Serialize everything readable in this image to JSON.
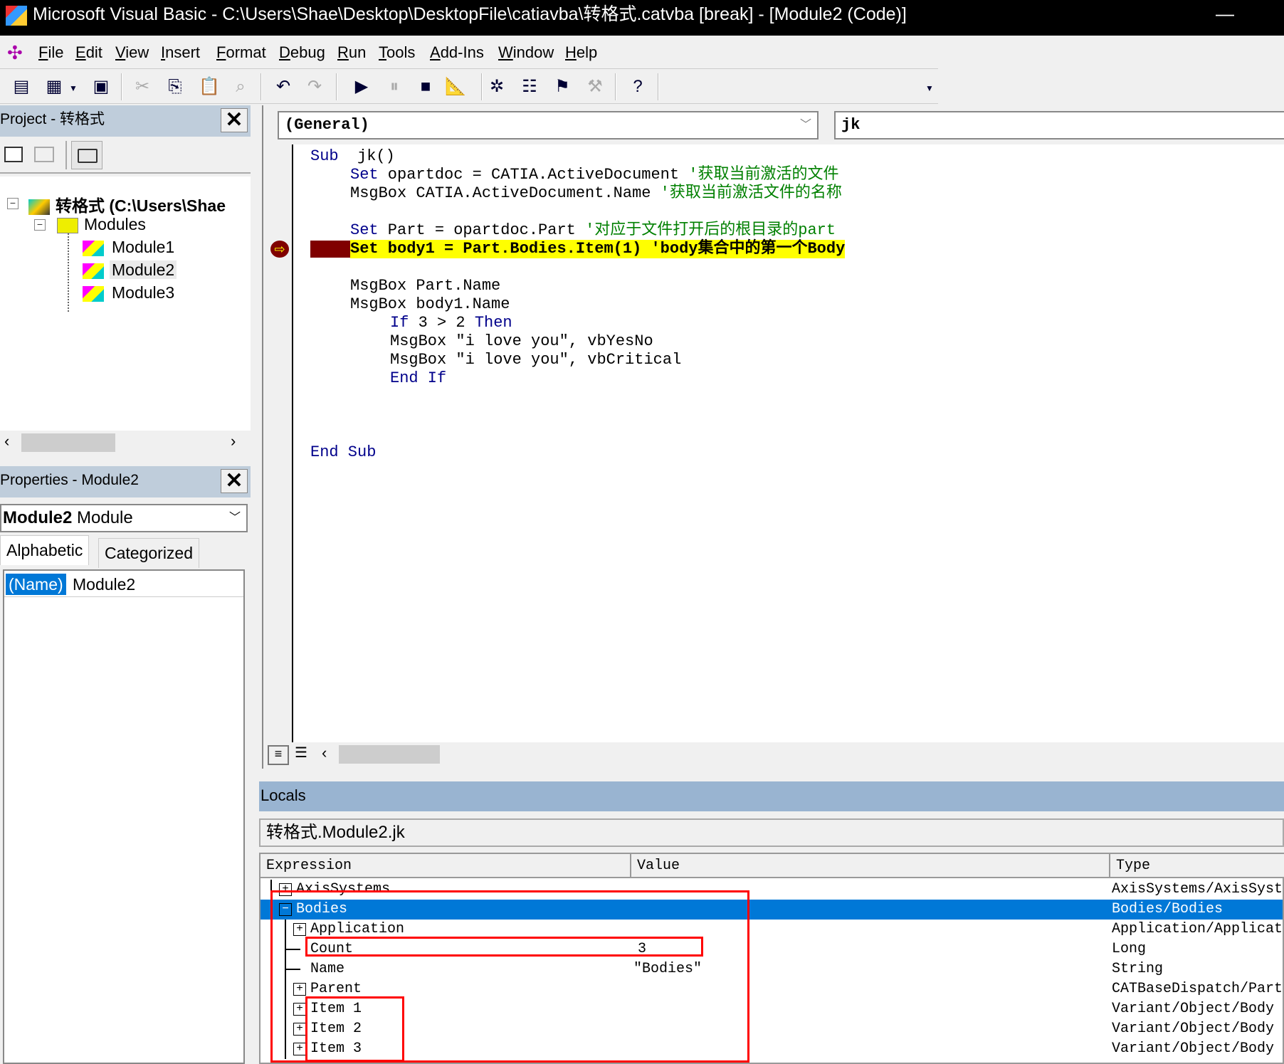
{
  "window": {
    "title": "Microsoft Visual Basic - C:\\Users\\Shae\\Desktop\\DesktopFile\\catiavba\\转格式.catvba [break] - [Module2 (Code)]"
  },
  "menu": [
    "File",
    "Edit",
    "View",
    "Insert",
    "Format",
    "Debug",
    "Run",
    "Tools",
    "Add-Ins",
    "Window",
    "Help"
  ],
  "toolbar": {
    "icons": [
      "view-object-icon",
      "insert-userform-icon",
      "save-icon",
      "cut-icon",
      "copy-icon",
      "paste-icon",
      "find-icon",
      "undo-icon",
      "redo-icon",
      "run-icon",
      "break-icon",
      "reset-icon",
      "design-mode-icon",
      "project-explorer-icon",
      "properties-window-icon",
      "object-browser-icon",
      "toolbox-icon",
      "help-icon"
    ]
  },
  "project": {
    "title": "Project - 转格式",
    "root": "转格式 (C:\\Users\\Shae",
    "folder": "Modules",
    "modules": [
      "Module1",
      "Module2",
      "Module3"
    ],
    "selected": "Module2"
  },
  "properties": {
    "title": "Properties - Module2",
    "object_name": "Module2",
    "object_type": "Module",
    "tabs": [
      "Alphabetic",
      "Categorized"
    ],
    "row": {
      "name": "(Name)",
      "value": "Module2"
    }
  },
  "code": {
    "object_combo": "(General)",
    "proc_combo": "jk",
    "lines": [
      {
        "indent": 0,
        "parts": [
          [
            "kw",
            "Sub"
          ],
          [
            "",
            "  jk()"
          ]
        ]
      },
      {
        "indent": 1,
        "parts": [
          [
            "kw",
            "Set"
          ],
          [
            "",
            " opartdoc = CATIA.ActiveDocument "
          ],
          [
            "cm",
            "'获取当前激活的文件"
          ]
        ]
      },
      {
        "indent": 1,
        "parts": [
          [
            "",
            "MsgBox CATIA.ActiveDocument.Name "
          ],
          [
            "cm",
            "'获取当前激活文件的名称"
          ]
        ]
      },
      {
        "indent": 0,
        "parts": []
      },
      {
        "indent": 1,
        "parts": [
          [
            "kw",
            "Set"
          ],
          [
            "",
            "",
            " "
          ],
          [
            "",
            " Part = opartdoc.Part "
          ],
          [
            "cm",
            "'对应于文件打开后的根目录的part"
          ]
        ]
      },
      {
        "indent": 1,
        "current": true,
        "parts": [
          [
            "",
            "Set body1 = Part.Bodies.Item(1) 'body集合中的第一个Body"
          ]
        ]
      },
      {
        "indent": 0,
        "parts": []
      },
      {
        "indent": 1,
        "parts": [
          [
            "",
            "MsgBox Part.Name"
          ]
        ]
      },
      {
        "indent": 1,
        "parts": [
          [
            "",
            "MsgBox body1.Name"
          ]
        ]
      },
      {
        "indent": 2,
        "parts": [
          [
            "kw",
            "If"
          ],
          [
            "",
            " 3 > 2 "
          ],
          [
            "kw",
            "Then"
          ]
        ]
      },
      {
        "indent": 2,
        "parts": [
          [
            "",
            "MsgBox \"i love you\", vbYesNo"
          ]
        ]
      },
      {
        "indent": 2,
        "parts": [
          [
            "",
            "MsgBox \"i love you\", vbCritical"
          ]
        ]
      },
      {
        "indent": 2,
        "parts": [
          [
            "kw",
            "End If"
          ]
        ]
      },
      {
        "indent": 0,
        "parts": []
      },
      {
        "indent": 0,
        "parts": []
      },
      {
        "indent": 0,
        "parts": []
      },
      {
        "indent": 0,
        "parts": [
          [
            "kw",
            "End Sub"
          ]
        ]
      }
    ]
  },
  "locals": {
    "title": "Locals",
    "context": "转格式.Module2.jk",
    "columns": [
      "Expression",
      "Value",
      "Type"
    ],
    "rows": [
      {
        "level": 0,
        "exp": "+",
        "expression": "AxisSystems",
        "value": "",
        "type": "AxisSystems/AxisSyst"
      },
      {
        "level": 0,
        "exp": "-",
        "expression": "Bodies",
        "value": "",
        "type": "Bodies/Bodies",
        "selected": true
      },
      {
        "level": 1,
        "exp": "+",
        "expression": "Application",
        "value": "",
        "type": "Application/Applicat"
      },
      {
        "level": 1,
        "exp": "",
        "expression": "Count",
        "value": "3",
        "type": "Long"
      },
      {
        "level": 1,
        "exp": "",
        "expression": "Name",
        "value": "\"Bodies\"",
        "type": "String"
      },
      {
        "level": 1,
        "exp": "+",
        "expression": "Parent",
        "value": "",
        "type": "CATBaseDispatch/Part"
      },
      {
        "level": 1,
        "exp": "+",
        "expression": "Item 1",
        "value": "",
        "type": "Variant/Object/Body"
      },
      {
        "level": 1,
        "exp": "+",
        "expression": "Item 2",
        "value": "",
        "type": "Variant/Object/Body"
      },
      {
        "level": 1,
        "exp": "+",
        "expression": "Item 3",
        "value": "",
        "type": "Variant/Object/Body"
      }
    ]
  },
  "colors": {
    "selection": "#0078d7",
    "panel_title": "#bfcddb",
    "locals_title": "#99b4d1",
    "current_line": "#ffff00",
    "breakpoint": "#800000",
    "keyword": "#00008b",
    "comment": "#008000",
    "annotation": "#ff0000"
  }
}
